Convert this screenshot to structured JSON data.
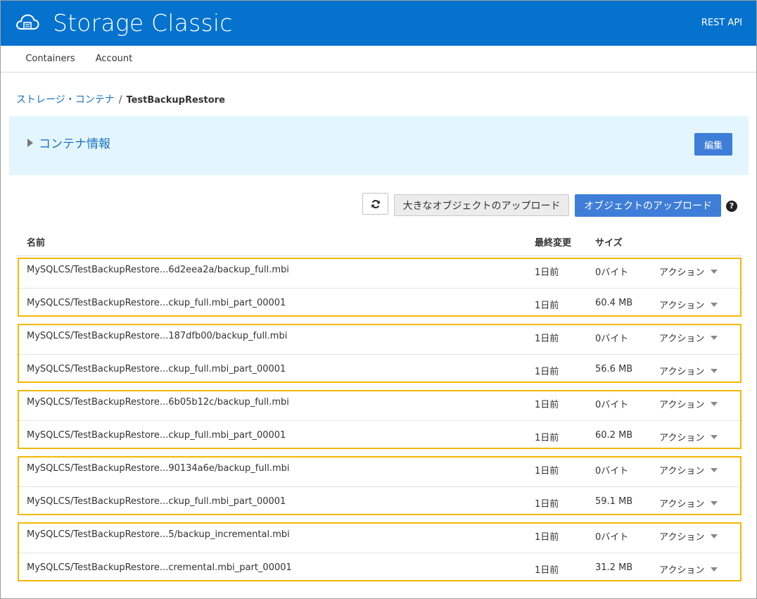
{
  "header": {
    "title": "Storage Classic",
    "rest_api": "REST API"
  },
  "tabs": [
    "Containers",
    "Account"
  ],
  "breadcrumb": {
    "parent": "ストレージ・コンテナ",
    "separator": "/",
    "current": "TestBackupRestore"
  },
  "info_panel": {
    "toggle_label": "コンテナ情報",
    "edit_label": "編集"
  },
  "toolbar": {
    "refresh_icon": "refresh-icon",
    "upload_large_label": "大きなオブジェクトのアップロード",
    "upload_object_label": "オブジェクトのアップロード",
    "help_glyph": "?"
  },
  "table": {
    "headers": {
      "name": "名前",
      "modified": "最終変更",
      "size": "サイズ"
    },
    "action_label": "アクション",
    "rows": [
      {
        "name": "MySQLCS/TestBackupRestore...6d2eea2a/backup_full.mbi",
        "modified": "1日前",
        "size": "0バイト"
      },
      {
        "name": "MySQLCS/TestBackupRestore...ckup_full.mbi_part_00001",
        "modified": "1日前",
        "size": "60.4 MB"
      },
      {
        "name": "MySQLCS/TestBackupRestore...187dfb00/backup_full.mbi",
        "modified": "1日前",
        "size": "0バイト"
      },
      {
        "name": "MySQLCS/TestBackupRestore...ckup_full.mbi_part_00001",
        "modified": "1日前",
        "size": "56.6 MB"
      },
      {
        "name": "MySQLCS/TestBackupRestore...6b05b12c/backup_full.mbi",
        "modified": "1日前",
        "size": "0バイト"
      },
      {
        "name": "MySQLCS/TestBackupRestore...ckup_full.mbi_part_00001",
        "modified": "1日前",
        "size": "60.2 MB"
      },
      {
        "name": "MySQLCS/TestBackupRestore...90134a6e/backup_full.mbi",
        "modified": "1日前",
        "size": "0バイト"
      },
      {
        "name": "MySQLCS/TestBackupRestore...ckup_full.mbi_part_00001",
        "modified": "1日前",
        "size": "59.1 MB"
      },
      {
        "name": "MySQLCS/TestBackupRestore...5/backup_incremental.mbi",
        "modified": "1日前",
        "size": "0バイト"
      },
      {
        "name": "MySQLCS/TestBackupRestore...cremental.mbi_part_00001",
        "modified": "1日前",
        "size": "31.2 MB"
      }
    ]
  },
  "colors": {
    "header_bg": "#0572ce",
    "primary_button": "#3e7ed8",
    "info_panel_bg": "#e4f6fd",
    "highlight_border": "#f2b705",
    "link": "#1a73c4"
  }
}
